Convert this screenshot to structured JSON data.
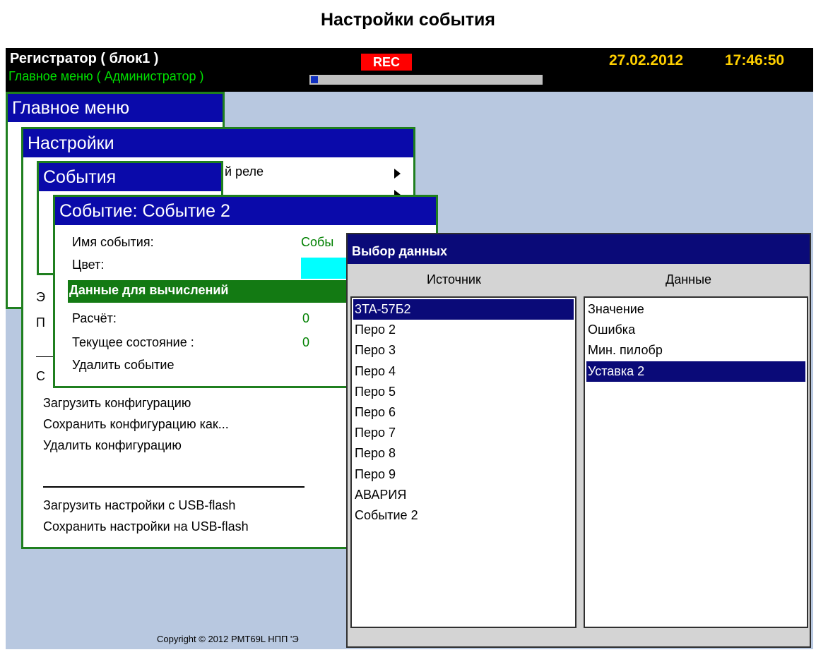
{
  "document_title": "Настройки события",
  "topbar": {
    "device_title": "Регистратор ( блок1 )",
    "menu_path": "Главное меню ( Администратор )",
    "rec_label": "REC",
    "date": "27.02.2012",
    "time": "17:46:50",
    "progress": 0.03
  },
  "main_menu": {
    "title": "Главное меню"
  },
  "settings_menu": {
    "title": "Настройки",
    "partial_items": [
      "й реле",
      "Э",
      "П",
      "С"
    ],
    "items": [
      "Загрузить конфигурацию",
      "Сохранить конфигурацию как...",
      "Удалить конфигурацию",
      "Загрузить настройки с USB-flash",
      "Сохранить настройки на USB-flash"
    ]
  },
  "events_menu": {
    "title": "События"
  },
  "event_window": {
    "title": "Событие: Событие 2",
    "name_label": "Имя события:",
    "name_value": "Собы",
    "color_label": "Цвет:",
    "color_value": "#00ffff",
    "data_label": "Данные для вычислений",
    "calc_label": "Расчёт:",
    "calc_value": "0",
    "state_label": "Текущее состояние :",
    "state_value": "0",
    "delete_label": "Удалить событие"
  },
  "data_dialog": {
    "title": "Выбор данных",
    "source_header": "Источник",
    "data_header": "Данные",
    "sources": [
      "3TA-57Б2",
      "Перо 2",
      "Перо 3",
      "Перо 4",
      "Перо 5",
      "Перо 6",
      "Перо 7",
      "Перо 8",
      "Перо 9",
      "АВАРИЯ",
      "Событие 2"
    ],
    "selected_source": 0,
    "data_items": [
      "Значение",
      "Ошибка",
      "Мин. пилобр",
      "Уставка 2"
    ],
    "selected_data": 3
  },
  "copyright": "Copyright © 2012 PMT69L НПП 'Э"
}
